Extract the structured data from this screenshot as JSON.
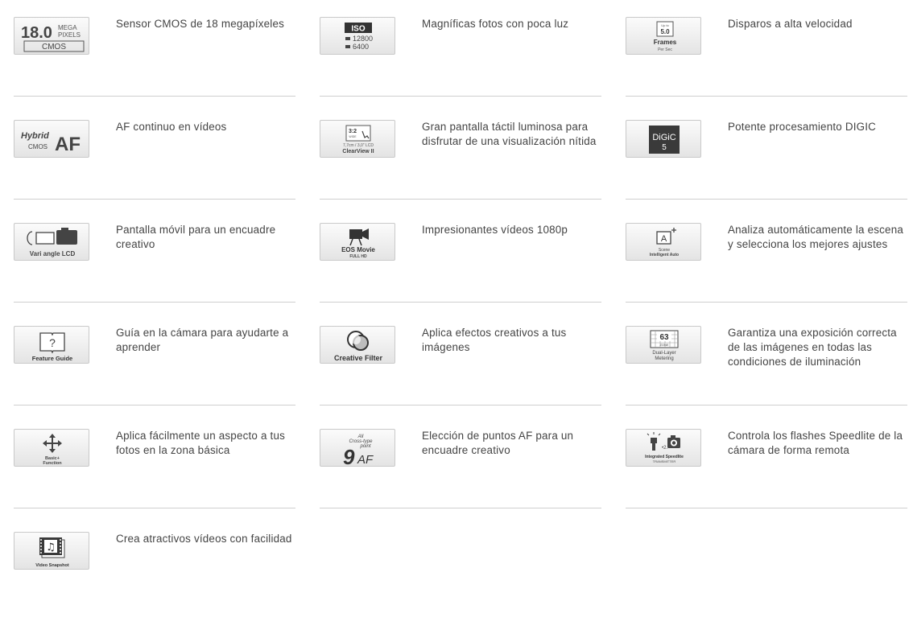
{
  "features": [
    {
      "icon": "18mp-cmos-icon",
      "text": "Sensor CMOS de 18 megapíxeles",
      "badge": [
        "18.0",
        "MEGA",
        "PIXELS",
        "CMOS"
      ]
    },
    {
      "icon": "iso-icon",
      "text": "Magníficas fotos con poca luz",
      "badge": [
        "ISO",
        "12800",
        "6400"
      ]
    },
    {
      "icon": "fps-icon",
      "text": "Disparos a alta velocidad",
      "badge": [
        "Up to",
        "5.0",
        "Frames",
        "Per Sec"
      ]
    },
    {
      "icon": "hybrid-af-icon",
      "text": "AF continuo en vídeos",
      "badge": [
        "Hybrid",
        "CMOS",
        "AF"
      ]
    },
    {
      "icon": "clearview-lcd-icon",
      "text": "Gran pantalla táctil luminosa para disfrutar de una visualización nítida",
      "badge": [
        "3:2",
        "WIDE",
        "7,7cm / 3,0\" LCD",
        "ClearView II"
      ]
    },
    {
      "icon": "digic-icon",
      "text": "Potente procesamiento DIGIC",
      "badge": [
        "DiGiC",
        "5"
      ]
    },
    {
      "icon": "vari-angle-icon",
      "text": "Pantalla móvil para un encuadre creativo",
      "badge": [
        "Vari angle LCD"
      ]
    },
    {
      "icon": "eos-movie-icon",
      "text": "Impresionantes vídeos 1080p",
      "badge": [
        "EOS Movie",
        "FULL HD"
      ]
    },
    {
      "icon": "scene-auto-icon",
      "text": "Analiza automáticamente la escena y selecciona los mejores ajustes",
      "badge": [
        "A",
        "Scene",
        "Intelligent Auto"
      ]
    },
    {
      "icon": "feature-guide-icon",
      "text": "Guía en la cámara para ayudarte a aprender",
      "badge": [
        "?",
        "Feature Guide"
      ]
    },
    {
      "icon": "creative-filter-icon",
      "text": "Aplica efectos creativos a tus imágenes",
      "badge": [
        "Creative Filter"
      ]
    },
    {
      "icon": "metering-icon",
      "text": "Garantiza una exposición correcta de las imágenes en todas las condiciones de iluminación",
      "badge": [
        "63",
        "ZONE",
        "Dual-Layer",
        "Metering"
      ]
    },
    {
      "icon": "basic-plus-icon",
      "text": "Aplica fácilmente un aspecto a tus fotos en la zona básica",
      "badge": [
        "Basic+",
        "Function"
      ]
    },
    {
      "icon": "af-points-icon",
      "text": "Elección de puntos AF para un encuadre creativo",
      "badge": [
        "All",
        "Cross-type",
        "point",
        "9",
        "AF"
      ]
    },
    {
      "icon": "speedlite-icon",
      "text": "Controla los flashes Speedlite de la cámara de forma remota",
      "badge": [
        "Integrated Speedlite",
        "TRANSMITTER"
      ]
    },
    {
      "icon": "video-snapshot-icon",
      "text": "Crea atractivos vídeos con facilidad",
      "badge": [
        "Video Snapshot"
      ]
    }
  ]
}
